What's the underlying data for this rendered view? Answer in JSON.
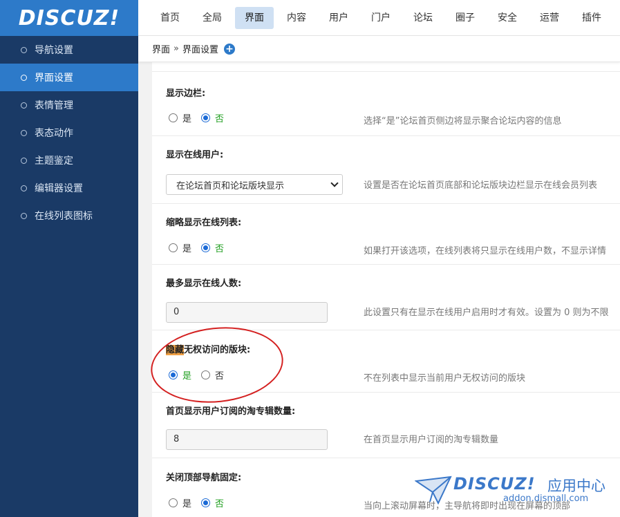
{
  "logo": "DISCUZ!",
  "topnav": [
    "首页",
    "全局",
    "界面",
    "内容",
    "用户",
    "门户",
    "论坛",
    "圈子",
    "安全",
    "运营",
    "插件"
  ],
  "topnav_active": "界面",
  "sidebar": [
    "导航设置",
    "界面设置",
    "表情管理",
    "表态动作",
    "主题鉴定",
    "编辑器设置",
    "在线列表图标"
  ],
  "sidebar_active": "界面设置",
  "breadcrumb": {
    "parent": "界面",
    "sep": "»",
    "current": "界面设置",
    "plus": "+"
  },
  "settings": {
    "sidebar": {
      "label": "显示边栏:",
      "yes": "是",
      "no": "否",
      "value": "no",
      "tip": "选择“是”论坛首页侧边将显示聚合论坛内容的信息"
    },
    "online_users": {
      "label": "显示在线用户:",
      "select": "在论坛首页和论坛版块显示",
      "tip": "设置是否在论坛首页底部和论坛版块边栏显示在线会员列表"
    },
    "online_brief": {
      "label": "缩略显示在线列表:",
      "yes": "是",
      "no": "否",
      "value": "no",
      "tip": "如果打开该选项，在线列表将只显示在线用户数，不显示详情"
    },
    "max_online": {
      "label": "最多显示在线人数:",
      "value": "0",
      "tip": "此设置只有在显示在线用户启用时才有效。设置为 0 则为不限"
    },
    "hide_private": {
      "label_hl": "隐藏",
      "label_rest": "无权访问的版块:",
      "yes": "是",
      "no": "否",
      "value": "yes",
      "tip": "不在列表中显示当前用户无权访问的版块"
    },
    "collection_count": {
      "label": "首页显示用户订阅的淘专辑数量:",
      "value": "8",
      "tip": "在首页显示用户订阅的淘专辑数量"
    },
    "close_topnav_fixed": {
      "label": "关闭顶部导航固定:",
      "yes": "是",
      "no": "否",
      "value": "no",
      "tip": "当向上滚动屏幕时，主导航将即时出现在屏幕的顶部"
    }
  },
  "watermark": {
    "brand": "DISCUZ!",
    "app": "应用中心",
    "url": "addon.dismall.com"
  }
}
